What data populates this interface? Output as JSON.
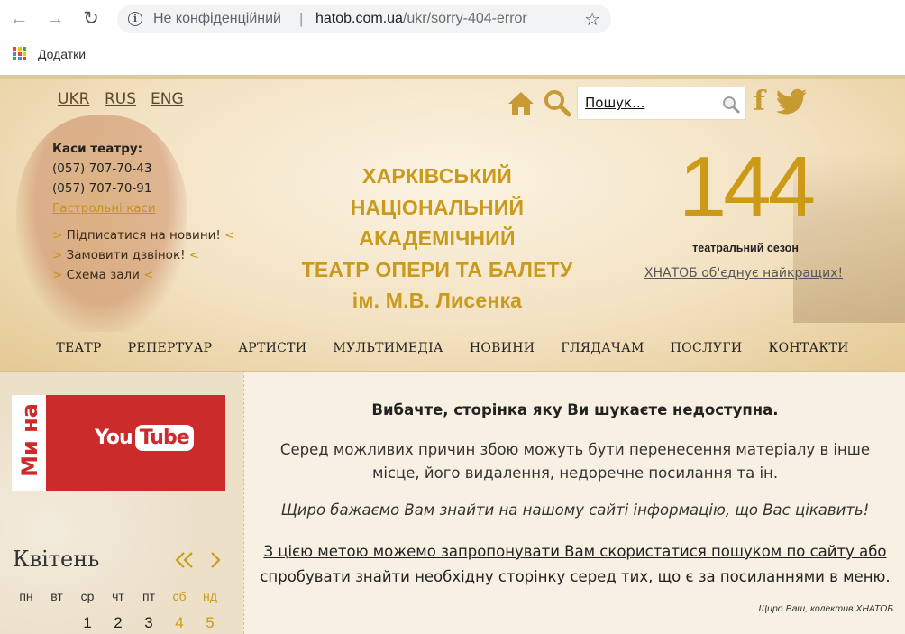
{
  "browser": {
    "security_label": "Не конфіденційний",
    "url_separator": "|",
    "url_domain": "hatob.com.ua",
    "url_path": "/ukr/sorry-404-error",
    "bookmarks_apps_label": "Додатки"
  },
  "header": {
    "languages": [
      "UKR",
      "RUS",
      "ENG"
    ],
    "search_placeholder": "Пошук...",
    "box_office": {
      "label": "Каси театру:",
      "phone1": "(057) 707-70-43",
      "phone2": "(057) 707-70-91",
      "tour_link": "Гастрольні каси"
    },
    "links": [
      {
        "prefix": "> ",
        "text": "Підписатися на новини!",
        "suffix": " <"
      },
      {
        "prefix": "> ",
        "text": "Замовити дзвінок!",
        "suffix": " <"
      },
      {
        "prefix": "> ",
        "text": "Схема зали",
        "suffix": " <"
      }
    ],
    "title_lines": [
      "ХАРКІВСЬКИЙ",
      "НАЦІОНАЛЬНИЙ АКАДЕМІЧНИЙ",
      "ТЕАТР ОПЕРИ ТА БАЛЕТУ",
      "ім. М.В. Лисенка"
    ],
    "season_number": "144",
    "season_label": "театральний сезон",
    "unite_link": "ХНАТОБ об'єднує найкращих!",
    "nav": [
      "ТЕАТР",
      "РЕПЕРТУАР",
      "АРТИСТИ",
      "МУЛЬТИМЕДІА",
      "НОВИНИ",
      "ГЛЯДАЧАМ",
      "ПОСЛУГИ",
      "КОНТАКТИ"
    ]
  },
  "sidebar": {
    "youtube_side_text": "Ми на",
    "youtube_you": "You",
    "youtube_tube": "Tube",
    "calendar": {
      "month": "Квітень",
      "weekdays": [
        "пн",
        "вт",
        "ср",
        "чт",
        "пт",
        "сб",
        "нд"
      ],
      "first_row": [
        "1",
        "2",
        "3",
        "4",
        "5"
      ]
    }
  },
  "content": {
    "title": "Вибачте, сторінка яку Ви шукаєте недоступна.",
    "reasons": "Серед можливих причин збою можуть бути перенесення матеріалу в інше місце, його видалення, недоречне посилання та ін.",
    "wish": "Щиро бажаємо Вам знайти на нашому сайті інформацію, що Вас цікавить!",
    "suggest": "З цією метою можемо запропонувати Вам скористатися пошуком по сайту або спробувати знайти необхідну сторінку серед тих, що є за посиланнями в меню.",
    "signature": "Щиро Ваш, колектив ХНАТОБ."
  },
  "colors": {
    "gold": "#cc9a17",
    "youtube_red": "#cc2b2b"
  }
}
